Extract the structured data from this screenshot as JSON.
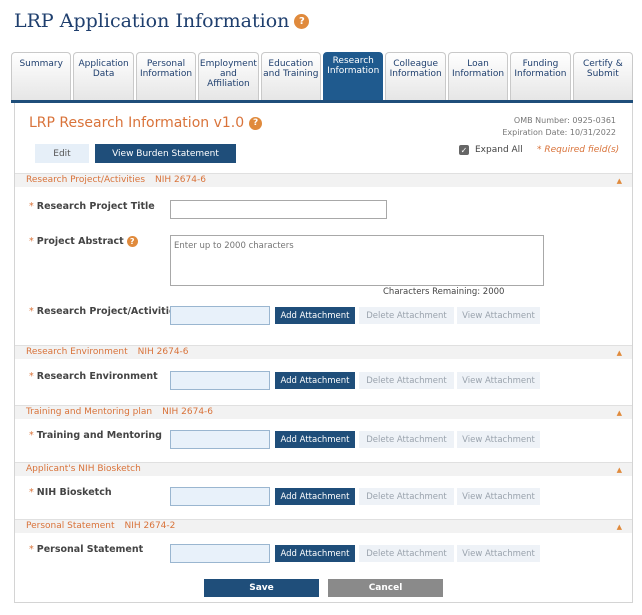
{
  "page": {
    "title": "LRP Application Information",
    "help_glyph": "?"
  },
  "tabs": [
    {
      "label": "Summary"
    },
    {
      "label": "Application\nData"
    },
    {
      "label": "Personal\nInformation"
    },
    {
      "label": "Employment\nand\nAffiliation"
    },
    {
      "label": "Education\nand Training"
    },
    {
      "label": "Research\nInformation",
      "active": true
    },
    {
      "label": "Colleague\nInformation"
    },
    {
      "label": "Loan\nInformation"
    },
    {
      "label": "Funding\nInformation"
    },
    {
      "label": "Certify &\nSubmit"
    }
  ],
  "form": {
    "title": "LRP Research Information v1.0",
    "omb_number": "OMB Number: 0925-0361",
    "expiration": "Expiration Date: 10/31/2022",
    "edit_label": "Edit",
    "burden_label": "View Burden Statement",
    "expand_label": "Expand All",
    "expand_checked": true,
    "required_note": "* Required field(s)",
    "required_star": "*"
  },
  "sections": [
    {
      "header": "Research Project/Activities",
      "nih": "NIH 2674-6",
      "fields": {
        "project_title_label": "Research Project Title",
        "project_title_value": "",
        "abstract_label": "Project Abstract",
        "abstract_placeholder": "Enter up to 2000 characters",
        "chars_remaining": "Characters Remaining: 2000",
        "attachment_label": "Research Project/Activities"
      }
    },
    {
      "header": "Research Environment",
      "nih": "NIH 2674-6",
      "attachment_label": "Research Environment"
    },
    {
      "header": "Training and Mentoring plan",
      "nih": "NIH 2674-6",
      "attachment_label": "Training and Mentoring"
    },
    {
      "header": "Applicant's NIH Biosketch",
      "nih": "",
      "attachment_label": "NIH Biosketch"
    },
    {
      "header": "Personal Statement",
      "nih": "NIH 2674-2",
      "attachment_label": "Personal Statement"
    }
  ],
  "attachment_buttons": {
    "add": "Add Attachment",
    "delete": "Delete Attachment",
    "view": "View Attachment"
  },
  "footer": {
    "save": "Save",
    "cancel": "Cancel"
  },
  "colors": {
    "brand_navy": "#1f4e7a",
    "accent_orange": "#d9733a"
  },
  "icons": {
    "help": "help-circle-icon",
    "collapse": "chevron-up-icon",
    "checkbox": "checkmark-icon"
  }
}
